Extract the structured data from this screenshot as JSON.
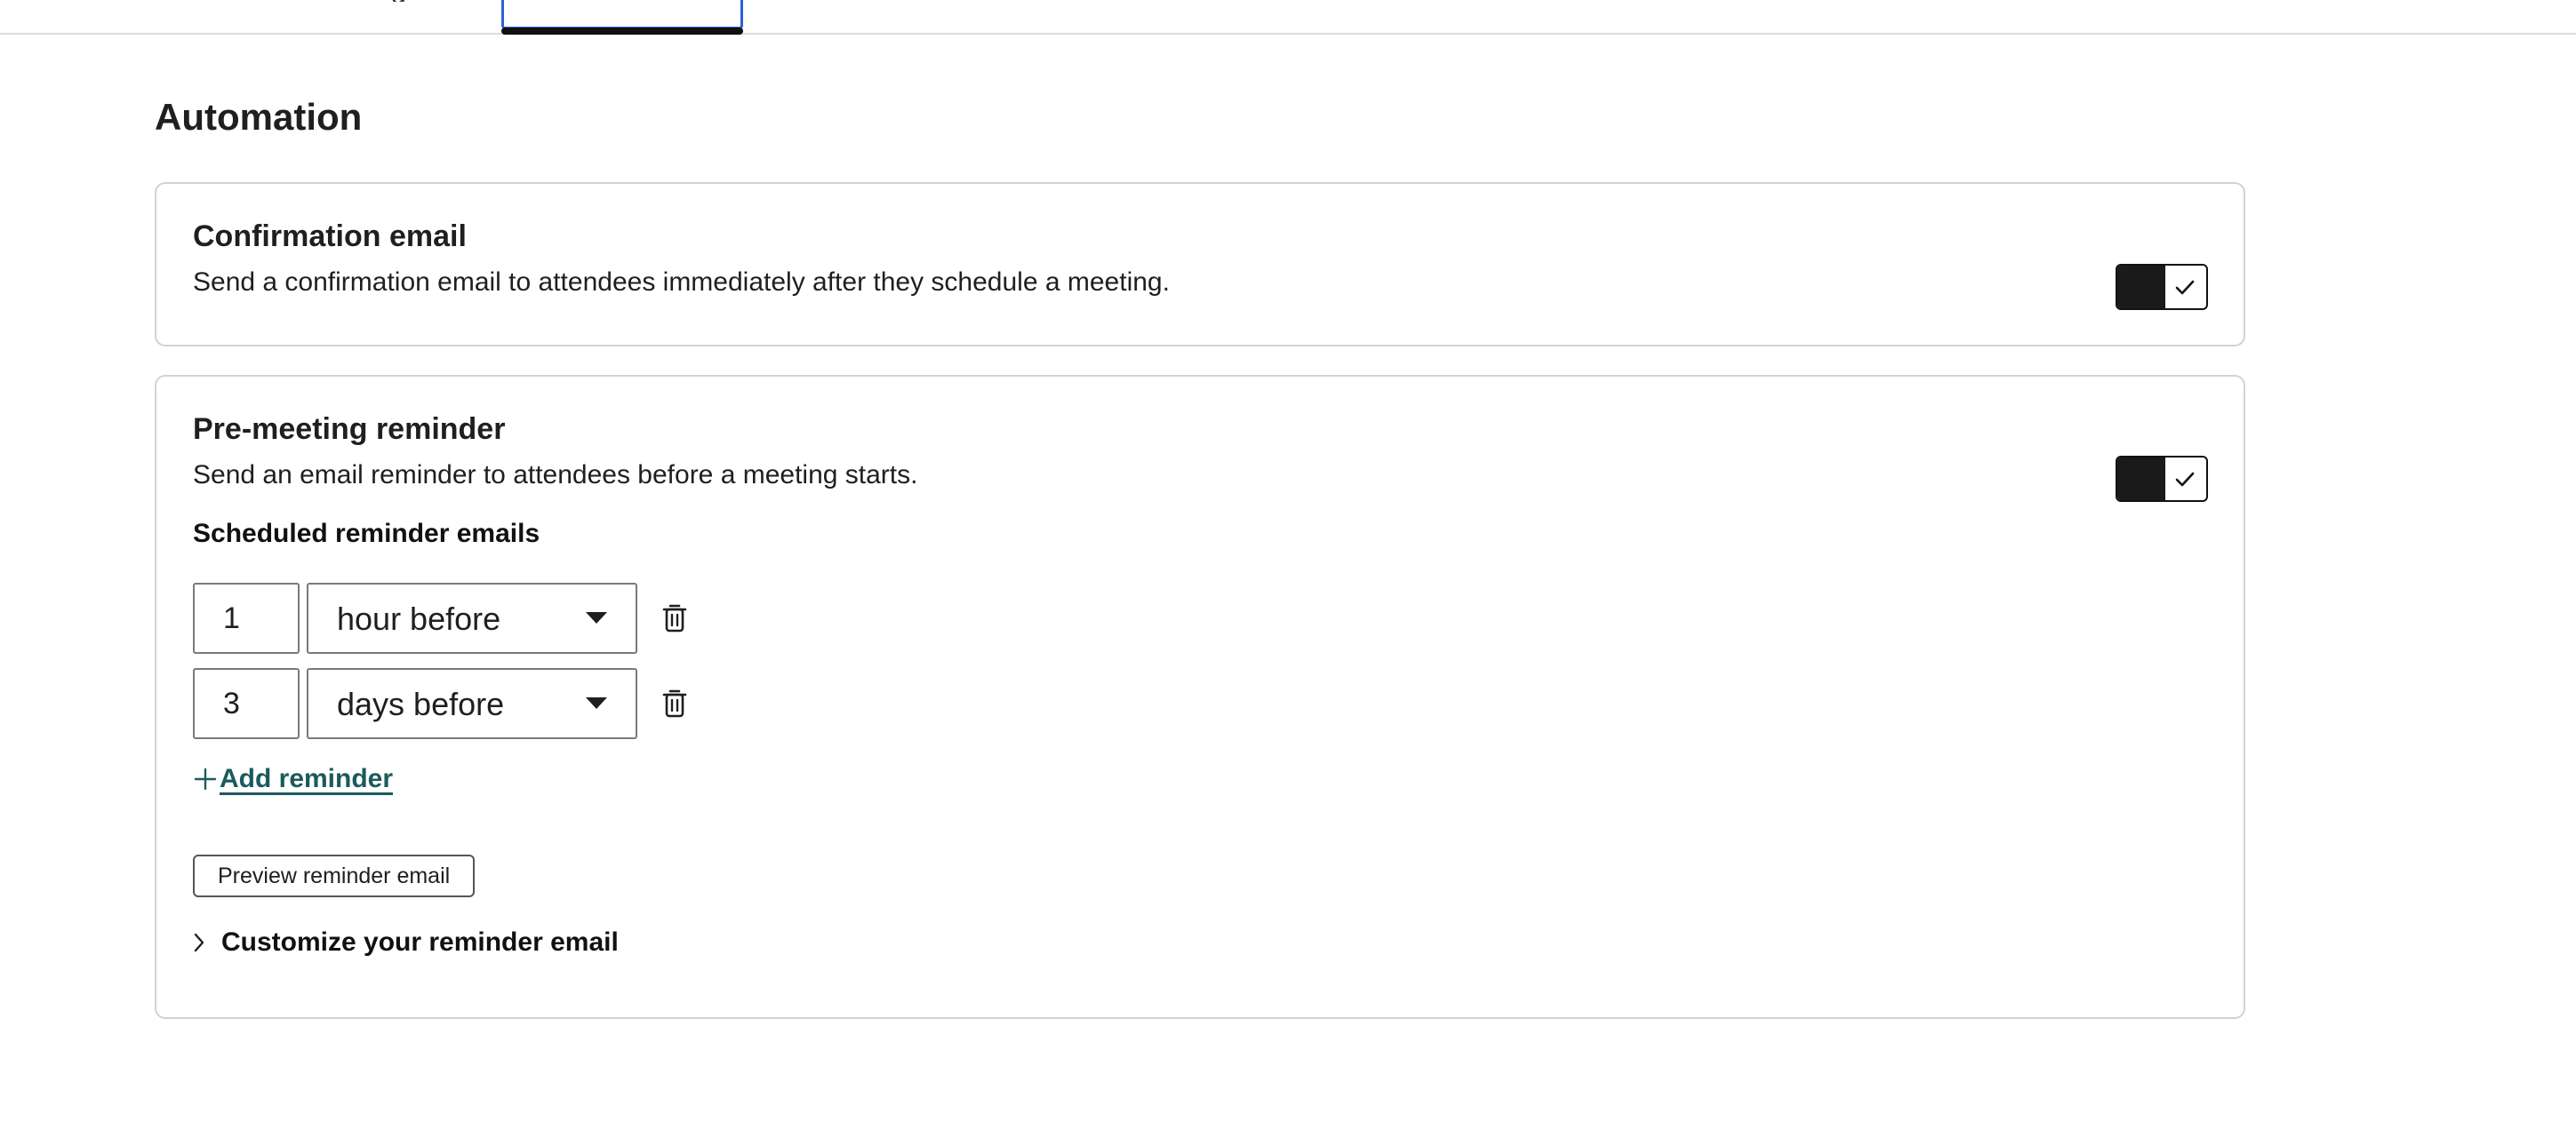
{
  "tabs": {
    "previous_fragment": "g"
  },
  "page": {
    "title": "Automation"
  },
  "confirmation": {
    "title": "Confirmation email",
    "description": "Send a confirmation email to attendees immediately after they schedule a meeting.",
    "enabled": true
  },
  "reminder": {
    "title": "Pre-meeting reminder",
    "description": "Send an email reminder to attendees before a meeting starts.",
    "enabled": true,
    "scheduled_label": "Scheduled reminder emails",
    "items": [
      {
        "amount": "1",
        "unit": "hour before"
      },
      {
        "amount": "3",
        "unit": "days before"
      }
    ],
    "add_label": "Add reminder",
    "preview_label": "Preview reminder email",
    "customize_label": "Customize your reminder email"
  },
  "colors": {
    "link": "#1c5a5c",
    "tab_focus": "#2a63d4",
    "toggle_on": "#1a1a1a",
    "card_border": "#d2d2d2"
  },
  "icons": {
    "toggle": "check-icon",
    "delete": "trash-icon",
    "add": "plus-icon",
    "expand": "chevron-right-icon",
    "dropdown": "caret-down-icon"
  }
}
